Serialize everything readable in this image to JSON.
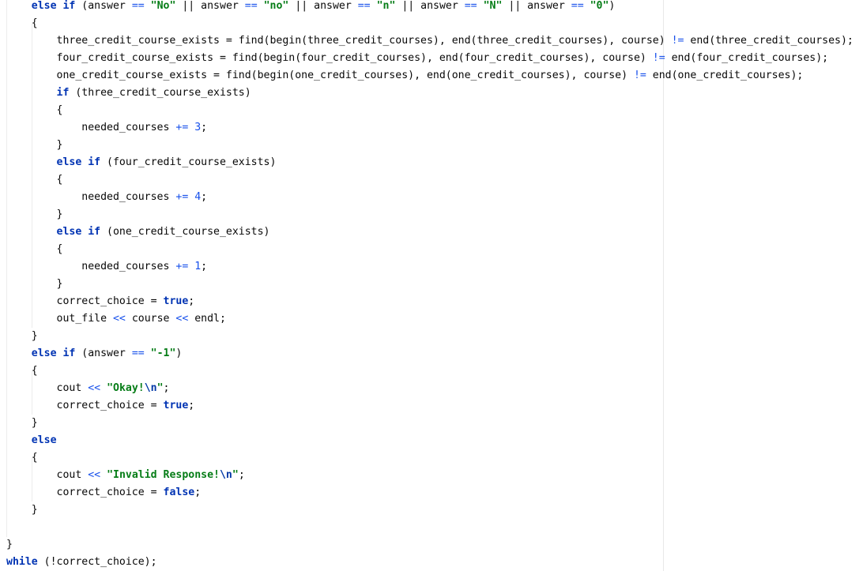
{
  "editor": {
    "language": "cpp",
    "colors": {
      "background": "#ffffff",
      "keyword": "#0033b3",
      "string": "#067d17",
      "number": "#1750eb",
      "operator": "#1750eb",
      "escape": "#0037a6",
      "text": "#080808",
      "margin_line": "#e8e8e8"
    },
    "lines": [
      [
        {
          "c": "    "
        },
        {
          "t": "kw",
          "c": "else if"
        },
        {
          "c": " (answer "
        },
        {
          "t": "op",
          "c": "=="
        },
        {
          "c": " "
        },
        {
          "t": "str",
          "c": "\"No\""
        },
        {
          "c": " || answer "
        },
        {
          "t": "op",
          "c": "=="
        },
        {
          "c": " "
        },
        {
          "t": "str",
          "c": "\"no\""
        },
        {
          "c": " || answer "
        },
        {
          "t": "op",
          "c": "=="
        },
        {
          "c": " "
        },
        {
          "t": "str",
          "c": "\"n\""
        },
        {
          "c": " || answer "
        },
        {
          "t": "op",
          "c": "=="
        },
        {
          "c": " "
        },
        {
          "t": "str",
          "c": "\"N\""
        },
        {
          "c": " || answer "
        },
        {
          "t": "op",
          "c": "=="
        },
        {
          "c": " "
        },
        {
          "t": "str",
          "c": "\"0\""
        },
        {
          "c": ")"
        }
      ],
      [
        {
          "c": "    {"
        }
      ],
      [
        {
          "c": "        three_credit_course_exists = find(begin(three_credit_courses), end(three_credit_courses), course) "
        },
        {
          "t": "op",
          "c": "!="
        },
        {
          "c": " end(three_credit_courses);"
        }
      ],
      [
        {
          "c": "        four_credit_course_exists = find(begin(four_credit_courses), end(four_credit_courses), course) "
        },
        {
          "t": "op",
          "c": "!="
        },
        {
          "c": " end(four_credit_courses);"
        }
      ],
      [
        {
          "c": "        one_credit_course_exists = find(begin(one_credit_courses), end(one_credit_courses), course) "
        },
        {
          "t": "op",
          "c": "!="
        },
        {
          "c": " end(one_credit_courses);"
        }
      ],
      [
        {
          "c": "        "
        },
        {
          "t": "kw",
          "c": "if"
        },
        {
          "c": " (three_credit_course_exists)"
        }
      ],
      [
        {
          "c": "        {"
        }
      ],
      [
        {
          "c": "            needed_courses "
        },
        {
          "t": "op",
          "c": "+="
        },
        {
          "c": " "
        },
        {
          "t": "num",
          "c": "3"
        },
        {
          "c": ";"
        }
      ],
      [
        {
          "c": "        }"
        }
      ],
      [
        {
          "c": "        "
        },
        {
          "t": "kw",
          "c": "else if"
        },
        {
          "c": " (four_credit_course_exists)"
        }
      ],
      [
        {
          "c": "        {"
        }
      ],
      [
        {
          "c": "            needed_courses "
        },
        {
          "t": "op",
          "c": "+="
        },
        {
          "c": " "
        },
        {
          "t": "num",
          "c": "4"
        },
        {
          "c": ";"
        }
      ],
      [
        {
          "c": "        }"
        }
      ],
      [
        {
          "c": "        "
        },
        {
          "t": "kw",
          "c": "else if"
        },
        {
          "c": " (one_credit_course_exists)"
        }
      ],
      [
        {
          "c": "        {"
        }
      ],
      [
        {
          "c": "            needed_courses "
        },
        {
          "t": "op",
          "c": "+="
        },
        {
          "c": " "
        },
        {
          "t": "num",
          "c": "1"
        },
        {
          "c": ";"
        }
      ],
      [
        {
          "c": "        }"
        }
      ],
      [
        {
          "c": "        correct_choice = "
        },
        {
          "t": "kw",
          "c": "true"
        },
        {
          "c": ";"
        }
      ],
      [
        {
          "c": "        out_file "
        },
        {
          "t": "op",
          "c": "<<"
        },
        {
          "c": " course "
        },
        {
          "t": "op",
          "c": "<<"
        },
        {
          "c": " endl;"
        }
      ],
      [
        {
          "c": "    }"
        }
      ],
      [
        {
          "c": "    "
        },
        {
          "t": "kw",
          "c": "else if"
        },
        {
          "c": " (answer "
        },
        {
          "t": "op",
          "c": "=="
        },
        {
          "c": " "
        },
        {
          "t": "str",
          "c": "\"-1\""
        },
        {
          "c": ")"
        }
      ],
      [
        {
          "c": "    {"
        }
      ],
      [
        {
          "c": "        cout "
        },
        {
          "t": "op",
          "c": "<<"
        },
        {
          "c": " "
        },
        {
          "t": "str",
          "c": "\"Okay!"
        },
        {
          "t": "esc",
          "c": "\\n"
        },
        {
          "t": "str",
          "c": "\""
        },
        {
          "c": ";"
        }
      ],
      [
        {
          "c": "        correct_choice = "
        },
        {
          "t": "kw",
          "c": "true"
        },
        {
          "c": ";"
        }
      ],
      [
        {
          "c": "    }"
        }
      ],
      [
        {
          "c": "    "
        },
        {
          "t": "kw",
          "c": "else"
        }
      ],
      [
        {
          "c": "    {"
        }
      ],
      [
        {
          "c": "        cout "
        },
        {
          "t": "op",
          "c": "<<"
        },
        {
          "c": " "
        },
        {
          "t": "str",
          "c": "\"Invalid Response!"
        },
        {
          "t": "esc",
          "c": "\\n"
        },
        {
          "t": "str",
          "c": "\""
        },
        {
          "c": ";"
        }
      ],
      [
        {
          "c": "        correct_choice = "
        },
        {
          "t": "kw",
          "c": "false"
        },
        {
          "c": ";"
        }
      ],
      [
        {
          "c": "    }"
        }
      ],
      [
        {
          "c": ""
        }
      ],
      [
        {
          "c": "}"
        }
      ],
      [
        {
          "t": "kw",
          "c": "while"
        },
        {
          "c": " (!correct_choice);"
        }
      ]
    ]
  }
}
